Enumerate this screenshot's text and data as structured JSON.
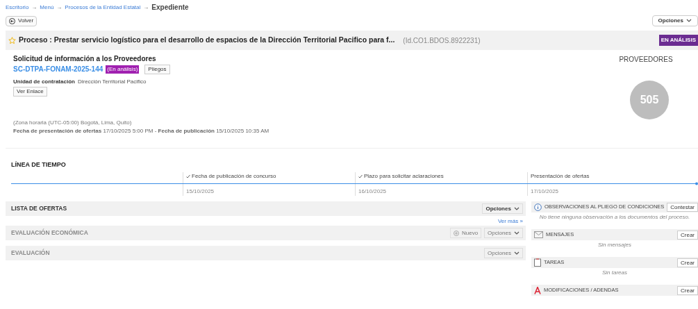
{
  "breadcrumb": {
    "items": [
      "Escritorio",
      "Menú",
      "Procesos de la Entidad Estatal"
    ],
    "separator": "→",
    "current": "Expediente"
  },
  "back_button": "Volver",
  "options_button": "Opciones",
  "process": {
    "favorite": false,
    "title": "Proceso : Prestar servicio logístico para el desarrollo de espacios de la Dirección Territorial Pacifico para f...",
    "id": "(Id.CO1.BDOS.8922231)",
    "status": "EN ANÁLISIS"
  },
  "summary": {
    "type": "Solicitud de información a los Proveedores",
    "code": "SC-DTPA-FONAM-2025-144",
    "code_status": "(En análisis)",
    "pliegos_button": "Pliegos",
    "unit_label": "Unidad de contratación",
    "unit_value": "Dirección Territorial Pacifico",
    "link_button": "Ver Enlace",
    "timezone": "(Zona horaria (UTC-05:00) Bogotá, Lima, Quito)",
    "dates": "**Fecha de presentación de ofertas** 17/10/2025 5:00 PM - **Fecha de publicación** 15/10/2025 10:35 AM"
  },
  "suppliers": {
    "title": "PROVEEDORES",
    "count": "505"
  },
  "timeline": {
    "title": "LÍNEA DE TIEMPO",
    "events": [
      {
        "label": "Fecha de publicación de concurso",
        "date": "15/10/2025",
        "done": true
      },
      {
        "label": "Plazo para solicitar aclaraciones",
        "date": "16/10/2025",
        "done": true
      },
      {
        "label": "Presentación de ofertas",
        "date": "17/10/2025",
        "done": false
      }
    ]
  },
  "sections": [
    {
      "title": "LISTA DE OFERTAS",
      "disabled": false,
      "options": "Opciones",
      "more_link": "Ver más »"
    },
    {
      "title": "EVALUACIÓN ECONÓMICA",
      "disabled": true,
      "new_button": "Nuevo",
      "options": "Opciones"
    },
    {
      "title": "EVALUACIÓN",
      "disabled": true,
      "options": "Opciones"
    }
  ],
  "side_panels": [
    {
      "kind": "observations",
      "title": "OBSERVACIONES AL PLIEGO DE CONDICIONES",
      "button": "Contestar",
      "empty": "No tiene ninguna observación a los documentos del proceso."
    },
    {
      "kind": "messages",
      "title": "MENSAJES",
      "button": "Crear",
      "empty": "Sin mensajes"
    },
    {
      "kind": "tasks",
      "title": "TAREAS",
      "button": "Crear",
      "empty": "Sin tareas"
    },
    {
      "kind": "amendments",
      "title": "MODIFICACIONES / ADENDAS",
      "button": "Crear"
    }
  ]
}
